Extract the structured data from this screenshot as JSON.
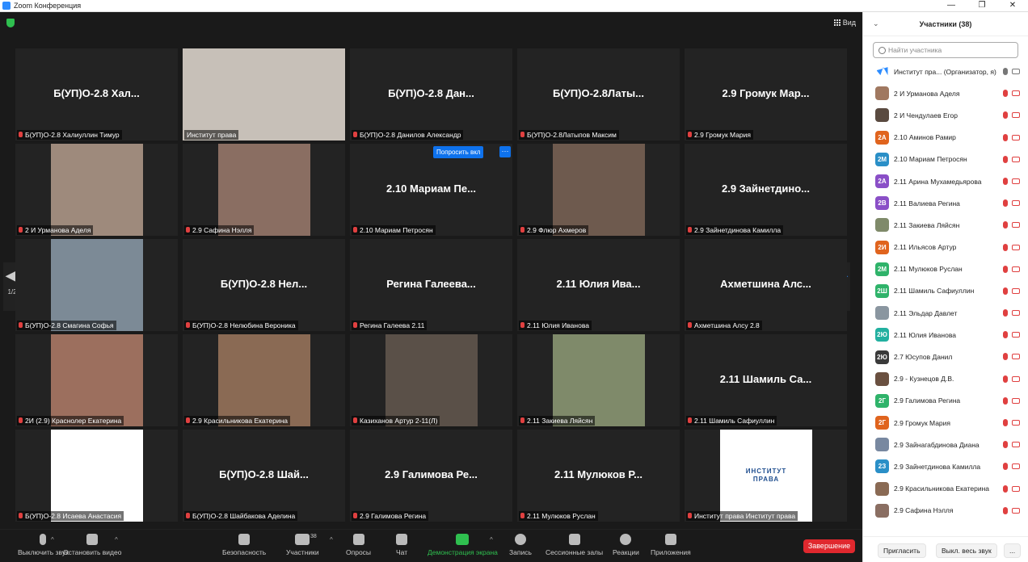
{
  "window": {
    "title": "Zoom Конференция"
  },
  "view_button": "Вид",
  "ask_unmute": {
    "label": "Попросить вкл",
    "more": "···"
  },
  "pager": {
    "page": "1/2"
  },
  "tiles": [
    {
      "big": "Б(УП)О-2.8  Хал...",
      "label": "Б(УП)О-2.8 Халиуллин Тимур"
    },
    {
      "big": "",
      "label": "Институт права",
      "photo": "#c7c0b8",
      "active": true
    },
    {
      "big": "Б(УП)О-2.8  Дан...",
      "label": "Б(УП)О-2.8 Данилов Александр"
    },
    {
      "big": "Б(УП)О-2.8Латы...",
      "label": "Б(УП)О-2.8Латыпов Максим"
    },
    {
      "big": "2.9  Громук  Мар...",
      "label": "2.9 Громук Мария"
    },
    {
      "big": "",
      "label": "2 И Урманова Аделя",
      "photo": "#9e8a7c"
    },
    {
      "big": "",
      "label": "2.9 Сафина Нэлля",
      "photo": "#8a6e62"
    },
    {
      "big": "2.10  Мариам  Пе...",
      "label": "2.10 Мариам Петросян"
    },
    {
      "big": "",
      "label": "2.9 Флюр Ахмеров",
      "photo": "#6e5a4e"
    },
    {
      "big": "2.9  Зайнетдино...",
      "label": "2.9 Зайнетдинова Камилла"
    },
    {
      "big": "",
      "label": "Б(УП)О-2.8 Смагина Софья",
      "photo": "#7c8a96"
    },
    {
      "big": "Б(УП)О-2.8  Нел...",
      "label": "Б(УП)О-2.8 Нелюбина Вероника"
    },
    {
      "big": "Регина  Галеева...",
      "label": "Регина Галеева 2.11"
    },
    {
      "big": "2.11  Юлия  Ива...",
      "label": "2.11 Юлия Иванова"
    },
    {
      "big": "Ахметшина  Алс...",
      "label": "Ахметшина Алсу 2.8"
    },
    {
      "big": "",
      "label": "2И (2.9) Краснолер Екатерина",
      "photo": "#9c6f5e"
    },
    {
      "big": "",
      "label": "2.9 Красильникова Екатерина",
      "photo": "#8a6a54"
    },
    {
      "big": "",
      "label": "Казиханов Артур 2-11(Л)",
      "photo": "#5a5048"
    },
    {
      "big": "",
      "label": "2.11 Закиева Ляйсян",
      "photo": "#7f8a6a"
    },
    {
      "big": "2.11  Шамиль  Са...",
      "label": "2.11 Шамиль Сафиуллин"
    },
    {
      "big": "",
      "label": "Б(УП)О-2.8 Исаева Анастасия",
      "photo": "#ffffff"
    },
    {
      "big": "Б(УП)О-2.8  Шай...",
      "label": "Б(УП)О-2.8 Шайбакова Аделина"
    },
    {
      "big": "2.9  Галимова  Ре...",
      "label": "2.9 Галимова Регина"
    },
    {
      "big": "2.11  Мулюков  Р...",
      "label": "2.11 Мулюков Руслан"
    },
    {
      "big": "",
      "label": "Институт права Институт права",
      "photo": "#ffffff",
      "logo_text": "ИНСТИТУТ ПРАВА"
    }
  ],
  "toolbar": {
    "mute": "Выключить звук",
    "stop_video": "Остановить видео",
    "security": "Безопасность",
    "participants": "Участники",
    "participants_count": "38",
    "polls": "Опросы",
    "chat": "Чат",
    "share": "Демонстрация экрана",
    "record": "Запись",
    "breakout": "Сессионные залы",
    "reactions": "Реакции",
    "apps": "Приложения",
    "end": "Завершение"
  },
  "panel": {
    "title": "Участники (38)",
    "search_placeholder": "Найти участника",
    "items": [
      {
        "avatar": "",
        "color": "#ffffff",
        "name": "Институт пра... (Организатор, я)"
      },
      {
        "avatar": "",
        "color": "#a07860",
        "name": "2 И Урманова Аделя"
      },
      {
        "avatar": "",
        "color": "#5a4a40",
        "name": "2 И Чендулаев Егор"
      },
      {
        "avatar": "2А",
        "color": "#e0641e",
        "name": "2.10 Аминов Рамир"
      },
      {
        "avatar": "2М",
        "color": "#2a8fc7",
        "name": "2.10 Мариам Петросян"
      },
      {
        "avatar": "2А",
        "color": "#8a4fc7",
        "name": "2.11 Арина Мухамедьярова"
      },
      {
        "avatar": "2В",
        "color": "#8a4fc7",
        "name": "2.11 Валиева Регина"
      },
      {
        "avatar": "",
        "color": "#7f8a6a",
        "name": "2.11 Закиева Ляйсян"
      },
      {
        "avatar": "2И",
        "color": "#e0641e",
        "name": "2.11 Ильясов Артур"
      },
      {
        "avatar": "2М",
        "color": "#2fb36a",
        "name": "2.11 Мулюков Руслан"
      },
      {
        "avatar": "2Ш",
        "color": "#2fb36a",
        "name": "2.11 Шамиль Сафиуллин"
      },
      {
        "avatar": "",
        "color": "#8a96a0",
        "name": "2.11 Эльдар Давлет"
      },
      {
        "avatar": "2Ю",
        "color": "#22b0a0",
        "name": "2.11 Юлия Иванова"
      },
      {
        "avatar": "2Ю",
        "color": "#3a3a3a",
        "name": "2.7 Юсупов Данил"
      },
      {
        "avatar": "",
        "color": "#6a5040",
        "name": "2.9 - Кузнецов Д.В."
      },
      {
        "avatar": "2Г",
        "color": "#2fb36a",
        "name": "2.9 Галимова Регина"
      },
      {
        "avatar": "2Г",
        "color": "#e0641e",
        "name": "2.9 Громук Мария"
      },
      {
        "avatar": "",
        "color": "#7888a0",
        "name": "2.9 Зайнагабдинова Диана"
      },
      {
        "avatar": "2З",
        "color": "#2a8fc7",
        "name": "2.9 Зайнетдинова Камилла"
      },
      {
        "avatar": "",
        "color": "#8a6a54",
        "name": "2.9 Красильникова Екатерина"
      },
      {
        "avatar": "",
        "color": "#8a6e62",
        "name": "2.9 Сафина Нэлля"
      }
    ],
    "invite": "Пригласить",
    "mute_all": "Выкл. весь звук",
    "more": "..."
  }
}
